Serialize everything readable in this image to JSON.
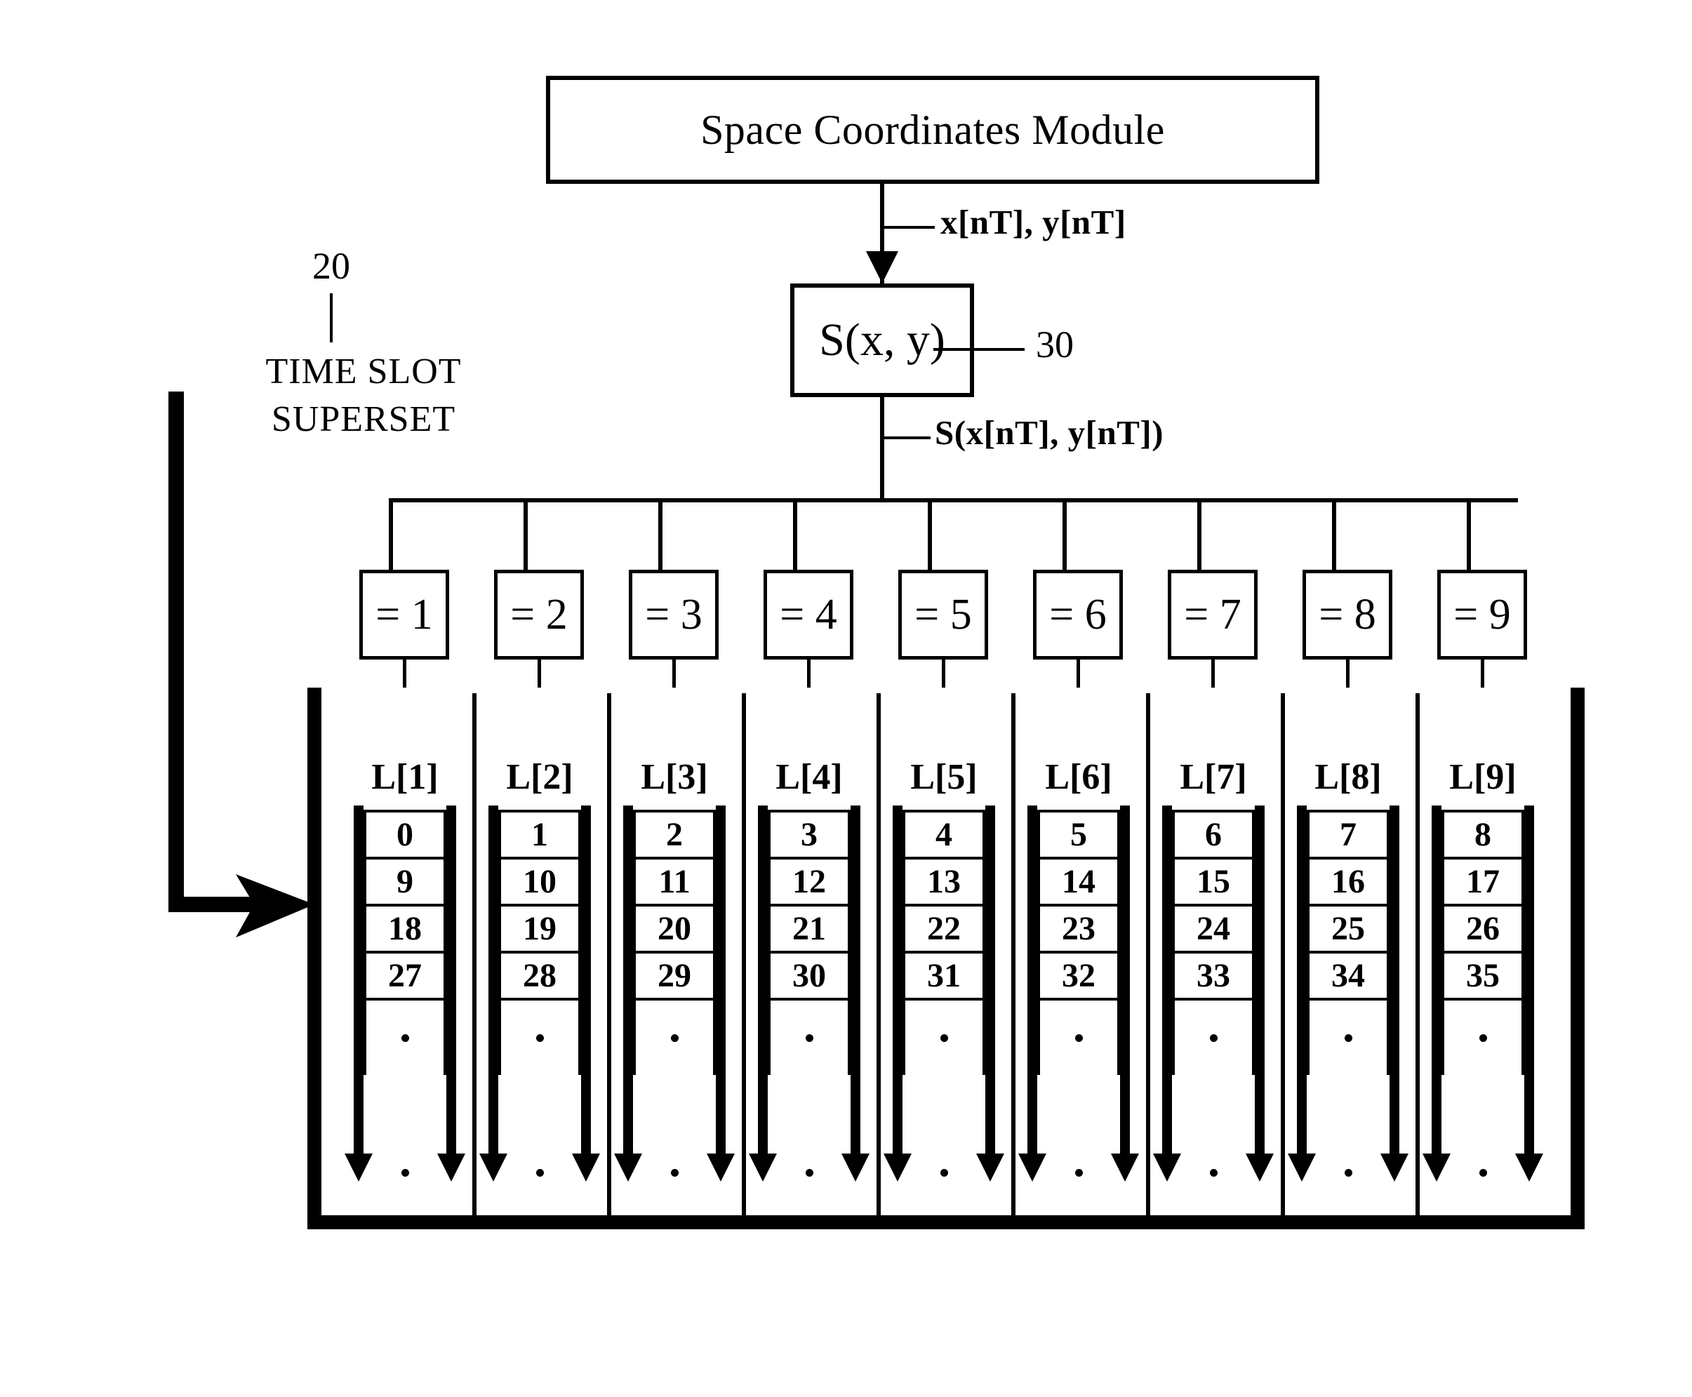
{
  "diagram": {
    "module": {
      "title": "Space Coordinates Module"
    },
    "mapper": {
      "label": "S(x, y)",
      "ref": "30"
    },
    "signals": {
      "coords": "x[nT], y[nT]",
      "mapped": "S(x[nT], y[nT])"
    },
    "superset": {
      "ref": "20",
      "caption_line1": "TIME SLOT",
      "caption_line2": "SUPERSET"
    },
    "selectors": [
      {
        "label": "= 1"
      },
      {
        "label": "= 2"
      },
      {
        "label": "= 3"
      },
      {
        "label": "= 4"
      },
      {
        "label": "= 5"
      },
      {
        "label": "= 6"
      },
      {
        "label": "= 7"
      },
      {
        "label": "= 8"
      },
      {
        "label": "= 9"
      }
    ],
    "queues": [
      {
        "head": "L[1]",
        "values": [
          "0",
          "9",
          "18",
          "27"
        ]
      },
      {
        "head": "L[2]",
        "values": [
          "1",
          "10",
          "19",
          "28"
        ]
      },
      {
        "head": "L[3]",
        "values": [
          "2",
          "11",
          "20",
          "29"
        ]
      },
      {
        "head": "L[4]",
        "values": [
          "3",
          "12",
          "21",
          "30"
        ]
      },
      {
        "head": "L[5]",
        "values": [
          "4",
          "13",
          "22",
          "31"
        ]
      },
      {
        "head": "L[6]",
        "values": [
          "5",
          "14",
          "23",
          "32"
        ]
      },
      {
        "head": "L[7]",
        "values": [
          "6",
          "15",
          "24",
          "33"
        ]
      },
      {
        "head": "L[8]",
        "values": [
          "7",
          "16",
          "25",
          "34"
        ]
      },
      {
        "head": "L[9]",
        "values": [
          "8",
          "17",
          "26",
          "35"
        ]
      }
    ],
    "colors": {
      "ink": "#000000",
      "paper": "#ffffff"
    }
  }
}
